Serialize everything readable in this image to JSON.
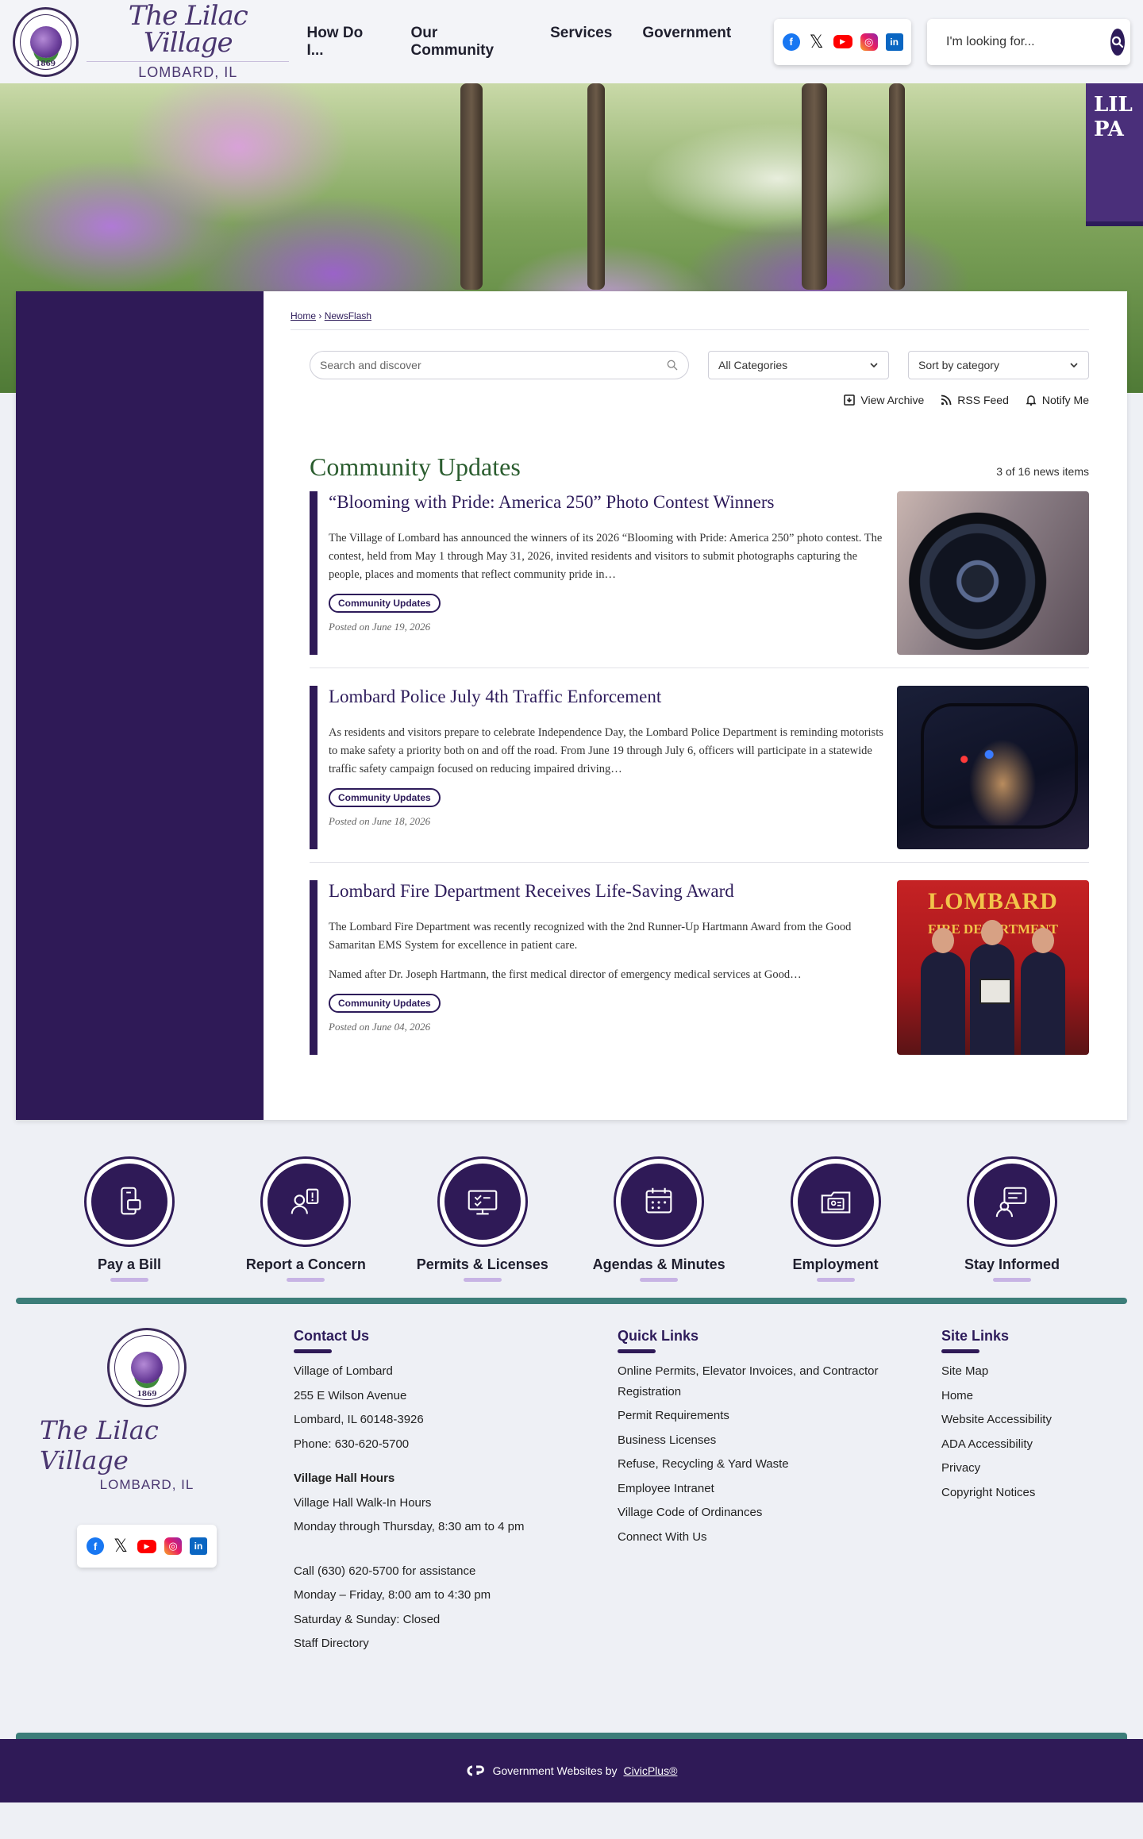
{
  "header": {
    "seal_year": "1869",
    "logo_script": "The Lilac Village",
    "logo_city": "LOMBARD, IL",
    "nav": [
      "How Do I...",
      "Our Community",
      "Services",
      "Government"
    ],
    "social": {
      "facebook": "f",
      "x": "𝕏",
      "youtube": "▶",
      "instagram": "◎",
      "linkedin": "in"
    },
    "search_placeholder": "I'm looking for..."
  },
  "hero": {
    "banner_text": "LIL PA"
  },
  "breadcrumb": {
    "home": "Home",
    "current": "NewsFlash"
  },
  "filters": {
    "search_placeholder": "Search and discover",
    "category": "All Categories",
    "sort": "Sort by category"
  },
  "actions": {
    "archive": "View Archive",
    "rss": "RSS Feed",
    "notify": "Notify Me"
  },
  "section": {
    "title": "Community Updates",
    "count": "3 of 16 news items"
  },
  "news": [
    {
      "title": "“Blooming with Pride: America 250” Photo Contest Winners",
      "text": "The Village of Lombard has announced the winners of its 2026 “Blooming with Pride: America 250” photo contest. The contest, held from May 1 through May 31, 2026, invited residents and visitors to submit photographs capturing the people, places and moments that reflect community pride in…",
      "tag": "Community Updates",
      "posted": "Posted on June 19, 2026"
    },
    {
      "title": "Lombard Police July 4th Traffic Enforcement",
      "text": "As residents and visitors prepare to celebrate Independence Day, the Lombard Police Department is reminding motorists to make safety a priority both on and off the road. From June 19 through July 6, officers will participate in a statewide traffic safety campaign focused on reducing impaired driving…",
      "tag": "Community Updates",
      "posted": "Posted on June 18, 2026"
    },
    {
      "title": "Lombard Fire Department Receives Life-Saving Award",
      "text": "The Lombard Fire Department was recently recognized with the 2nd Runner-Up Hartmann Award from the Good Samaritan EMS System for excellence in patient care.",
      "text2": "Named after Dr. Joseph Hartmann, the first medical director of emergency medical services at Good…",
      "tag": "Community Updates",
      "posted": "Posted on June 04, 2026",
      "img_text1": "LOMBARD",
      "img_text2": "FIRE DEPARTMENT"
    }
  ],
  "quick_links": [
    "Pay a Bill",
    "Report a Concern",
    "Permits & Licenses",
    "Agendas & Minutes",
    "Employment",
    "Stay Informed"
  ],
  "footer": {
    "contact": {
      "heading": "Contact Us",
      "lines": [
        "Village of Lombard",
        "255 E Wilson Avenue",
        "Lombard, IL 60148-3926",
        "Phone: 630-620-5700"
      ],
      "hours_heading": "Village Hall Hours",
      "hours": [
        "Village Hall Walk-In Hours",
        "Monday through Thursday, 8:30 am to 4 pm"
      ],
      "assist": [
        "Call (630) 620-5700 for assistance",
        "Monday – Friday, 8:00 am to 4:30 pm",
        "Saturday & Sunday: Closed",
        "Staff Directory"
      ]
    },
    "quick": {
      "heading": "Quick Links",
      "links": [
        "Online Permits, Elevator Invoices, and Contractor Registration",
        "Permit Requirements",
        "Business Licenses",
        "Refuse, Recycling & Yard Waste",
        "Employee Intranet",
        "Village Code of Ordinances",
        "Connect With Us"
      ]
    },
    "site": {
      "heading": "Site Links",
      "links": [
        "Site Map",
        "Home",
        "Website Accessibility",
        "ADA Accessibility",
        "Privacy",
        "Copyright Notices"
      ]
    }
  },
  "bottom": {
    "text": "Government Websites by",
    "brand": "CivicPlus®"
  }
}
